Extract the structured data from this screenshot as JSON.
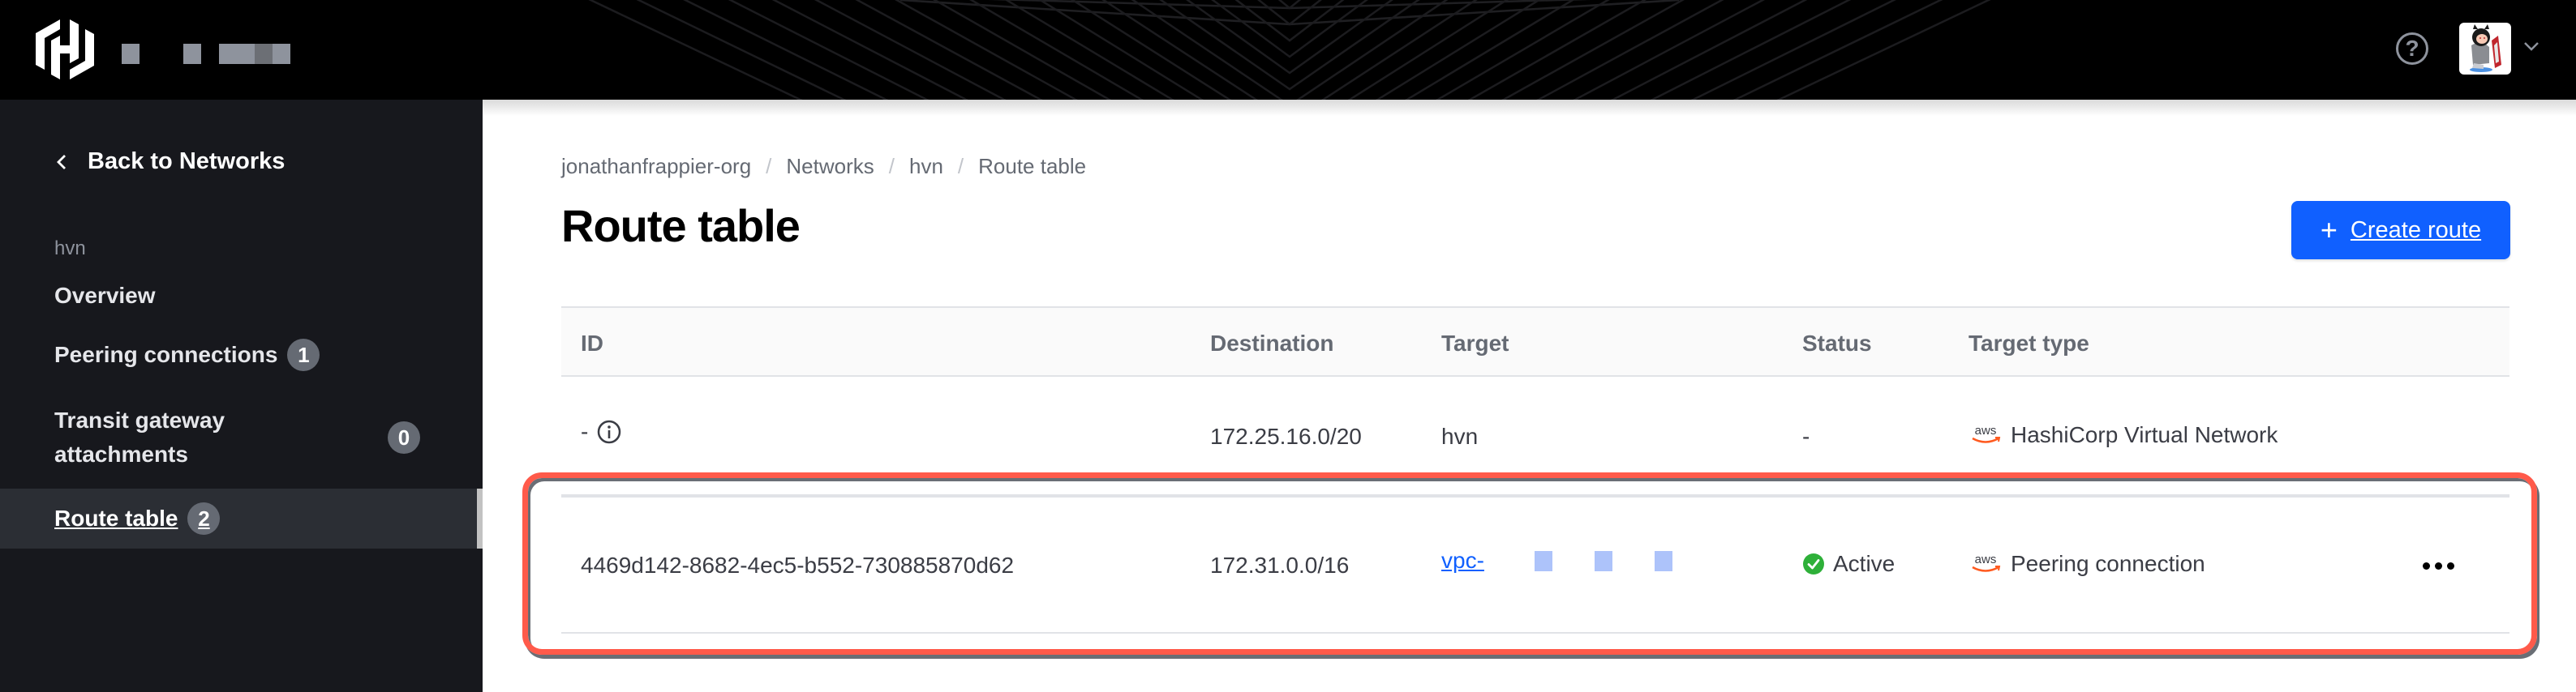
{
  "topnav": {
    "logo": "hashicorp-logo",
    "org_name_redacted": true,
    "help_icon": "question-circle-icon",
    "help_glyph": "?",
    "avatar": "user-avatar",
    "avatar_menu_icon": "chevron-down-icon"
  },
  "sidebar": {
    "back_label": "Back to Networks",
    "section_label": "hvn",
    "items": [
      {
        "label": "Overview",
        "badge": null,
        "active": false
      },
      {
        "label": "Peering connections",
        "badge": "1",
        "active": false
      },
      {
        "label": "Transit gateway attachments",
        "badge": "0",
        "active": false
      },
      {
        "label": "Route table",
        "badge": "2",
        "active": true
      }
    ]
  },
  "breadcrumb": [
    {
      "label": "jonathanfrappier-org"
    },
    {
      "label": "Networks"
    },
    {
      "label": "hvn"
    },
    {
      "label": "Route table"
    }
  ],
  "breadcrumb_separator": "/",
  "page": {
    "title": "Route table",
    "create_button": {
      "icon": "plus-icon",
      "glyph": "+",
      "label": "Create route"
    }
  },
  "table": {
    "columns": [
      "ID",
      "Destination",
      "Target",
      "Status",
      "Target type"
    ],
    "rows": [
      {
        "id": "-",
        "id_info_icon": true,
        "destination": "172.25.16.0/20",
        "target": "hvn",
        "target_is_link": false,
        "status": "-",
        "status_icon": null,
        "target_type": "HashiCorp Virtual Network",
        "target_type_icon": "aws-icon",
        "has_actions": false
      },
      {
        "id": "4469d142-8682-4ec5-b552-730885870d62",
        "id_info_icon": false,
        "destination": "172.31.0.0/16",
        "target": "vpc-",
        "target_is_link": true,
        "target_redacted": true,
        "status": "Active",
        "status_icon": "check-circle-icon",
        "target_type": "Peering connection",
        "target_type_icon": "aws-icon",
        "has_actions": true,
        "highlighted": true
      }
    ]
  },
  "colors": {
    "brand_blue": "#1060ff",
    "status_active": "#2eb039",
    "highlight": "#ff5a4a",
    "aws_orange": "#ff9900",
    "sidebar_bg": "#17181d",
    "badge_bg": "#656a73"
  }
}
